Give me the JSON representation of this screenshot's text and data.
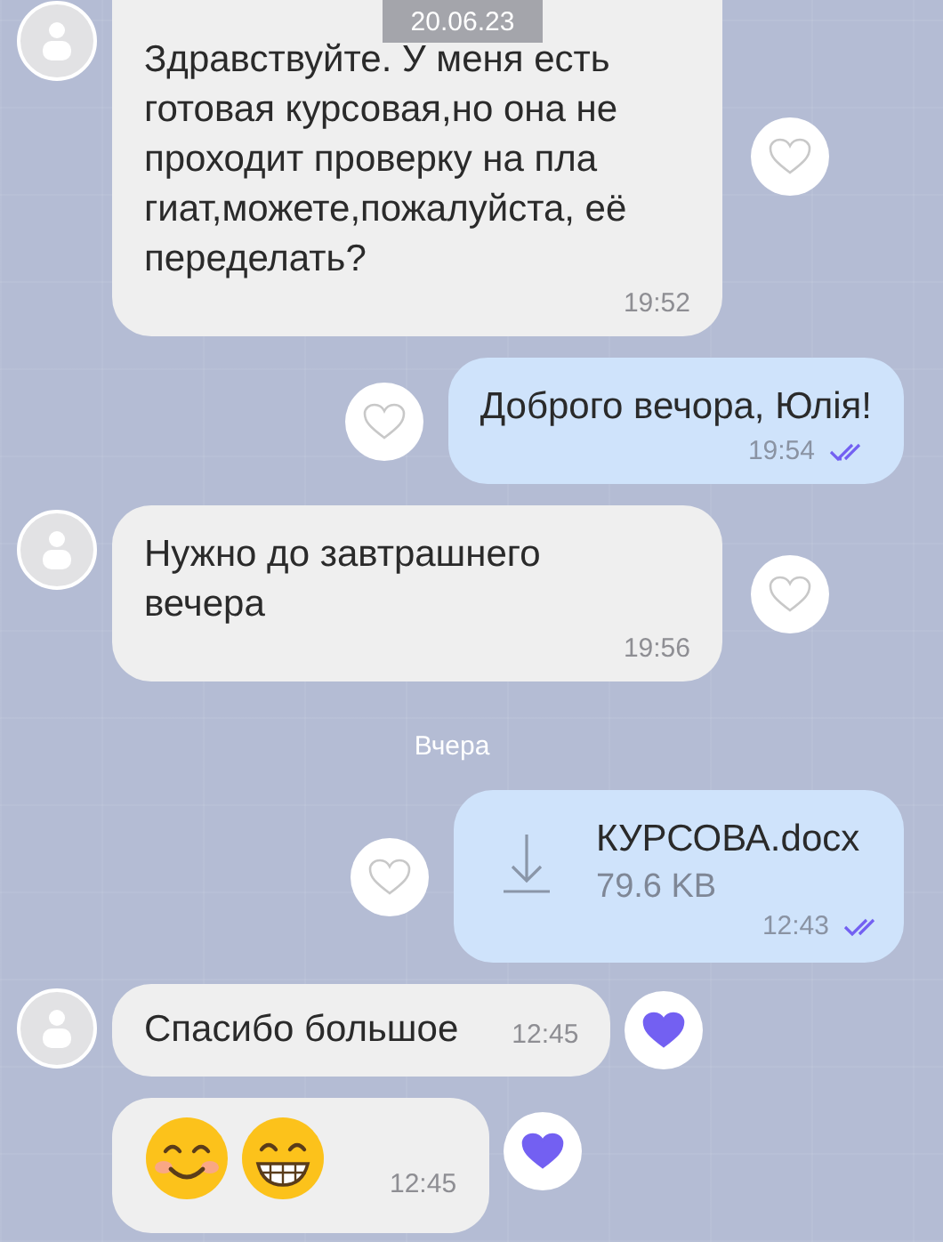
{
  "date_badge": "20.06.23",
  "messages": [
    {
      "kind": "text",
      "incoming": true,
      "avatar": true,
      "lines": [
        "Здравствуйте. У меня есть",
        "готовая курсовая,но она не",
        "проходит проверку на пла",
        "гиат,можете,пожалуйста, её",
        "переделать?"
      ],
      "time": "19:52",
      "liked": false
    },
    {
      "kind": "text",
      "incoming": false,
      "lines": [
        "Доброго вечора, Юлія!"
      ],
      "time": "19:54",
      "read": true,
      "liked": false
    },
    {
      "kind": "text",
      "incoming": true,
      "avatar": true,
      "lines": [
        "Нужно до завтрашнего",
        "вечера"
      ],
      "time": "19:56",
      "liked": false
    },
    {
      "kind": "date",
      "label": "Вчера"
    },
    {
      "kind": "file",
      "incoming": false,
      "file_name": "КУРСОВА.docx",
      "file_size": "79.6 KB",
      "time": "12:43",
      "read": true,
      "liked": false
    },
    {
      "kind": "text",
      "incoming": true,
      "avatar": true,
      "lines": [
        "Спасибо большое"
      ],
      "time": "12:45",
      "liked": true
    },
    {
      "kind": "emoji",
      "incoming": true,
      "avatar": false,
      "emojis": [
        {
          "kind": "smiling"
        },
        {
          "kind": "grinning"
        }
      ],
      "time": "12:45",
      "liked": true
    }
  ]
}
